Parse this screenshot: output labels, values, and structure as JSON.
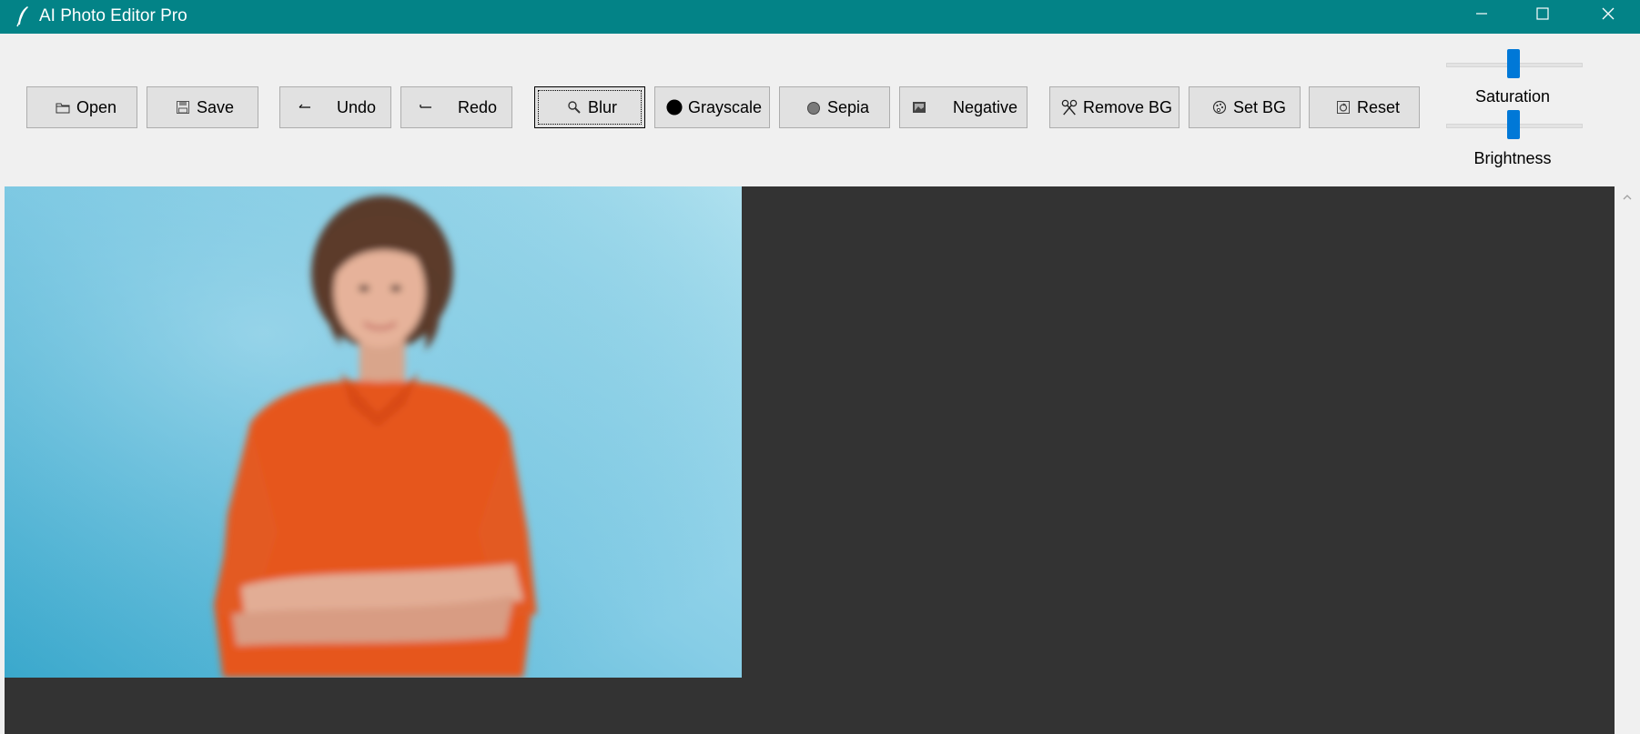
{
  "window": {
    "title": "AI Photo Editor Pro",
    "title_bar_color": "#038387"
  },
  "icons": {
    "app": "feather-icon",
    "minimize": "minimize-icon",
    "maximize": "maximize-icon",
    "close": "close-icon"
  },
  "toolbar": {
    "open_label": "Open",
    "save_label": "Save",
    "undo_label": "Undo",
    "redo_label": "Redo",
    "blur_label": "Blur",
    "grayscale_label": "Grayscale",
    "sepia_label": "Sepia",
    "negative_label": "Negative",
    "remove_bg_label": "Remove BG",
    "set_bg_label": "Set BG",
    "reset_label": "Reset"
  },
  "sliders": {
    "saturation": {
      "label": "Saturation",
      "value": 0.5
    },
    "brightness": {
      "label": "Brightness",
      "value": 0.5
    }
  },
  "canvas": {
    "background": "#333333",
    "image_subject": "portrait-photo-woman-orange-shirt-blurred",
    "photo_background_color": "#7cc8e0"
  },
  "accent_color": "#0078d7"
}
